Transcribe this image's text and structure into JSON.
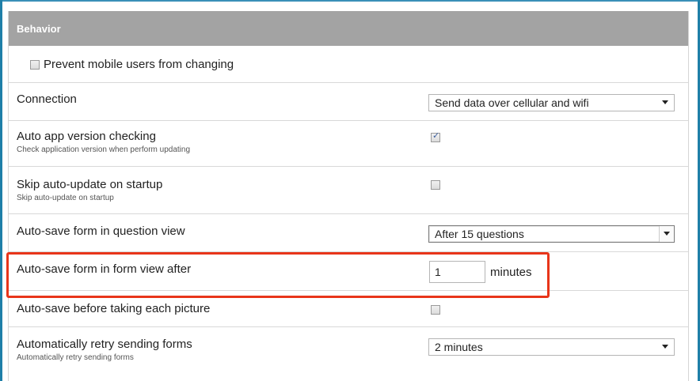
{
  "section": {
    "title": "Behavior"
  },
  "rows": {
    "prevent": {
      "label": "Prevent mobile users from changing",
      "checked": false
    },
    "connection": {
      "label": "Connection",
      "value": "Send data over cellular and wifi"
    },
    "auto_app_version": {
      "label": "Auto app version checking",
      "sublabel": "Check application version when perform updating",
      "checked": true
    },
    "skip_auto_update": {
      "label": "Skip auto-update on startup",
      "sublabel": "Skip auto-update on startup",
      "checked": false
    },
    "autosave_question": {
      "label": "Auto-save form in question view",
      "value": "After 15 questions"
    },
    "autosave_form": {
      "label": "Auto-save form in form view after",
      "value": "1",
      "units": "minutes"
    },
    "autosave_picture": {
      "label": "Auto-save before taking each picture",
      "checked": false
    },
    "retry_sending": {
      "label": "Automatically retry sending forms",
      "sublabel": "Automatically retry sending forms",
      "value": "2 minutes"
    }
  },
  "colors": {
    "header_bg": "#a3a3a3",
    "highlight": "#e8351a",
    "frame": "#1f7fa8"
  }
}
